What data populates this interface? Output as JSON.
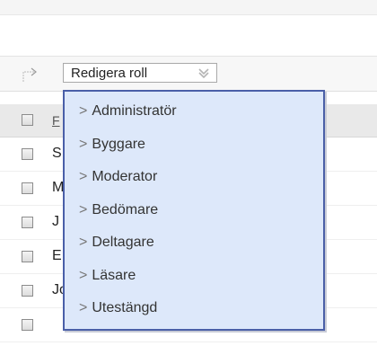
{
  "toolbar": {
    "edit_role_label": "Redigera roll"
  },
  "role_menu": {
    "items": [
      {
        "label": "Administratör"
      },
      {
        "label": "Byggare"
      },
      {
        "label": "Moderator"
      },
      {
        "label": "Bedömare"
      },
      {
        "label": "Deltagare"
      },
      {
        "label": "Läsare"
      },
      {
        "label": "Utestängd"
      }
    ]
  },
  "table": {
    "header_partial": "F",
    "rows": [
      {
        "partial_name": "S"
      },
      {
        "partial_name": "M"
      },
      {
        "partial_name": "J"
      },
      {
        "partial_name": "E"
      },
      {
        "partial_name": "Johan"
      }
    ]
  },
  "icons": {
    "toolbar_icon": "move-arrow-icon",
    "dropdown_icon": "double-chevron-down-icon"
  },
  "colors": {
    "menu_background": "#dde8fa",
    "menu_border": "#4a5fa8"
  }
}
